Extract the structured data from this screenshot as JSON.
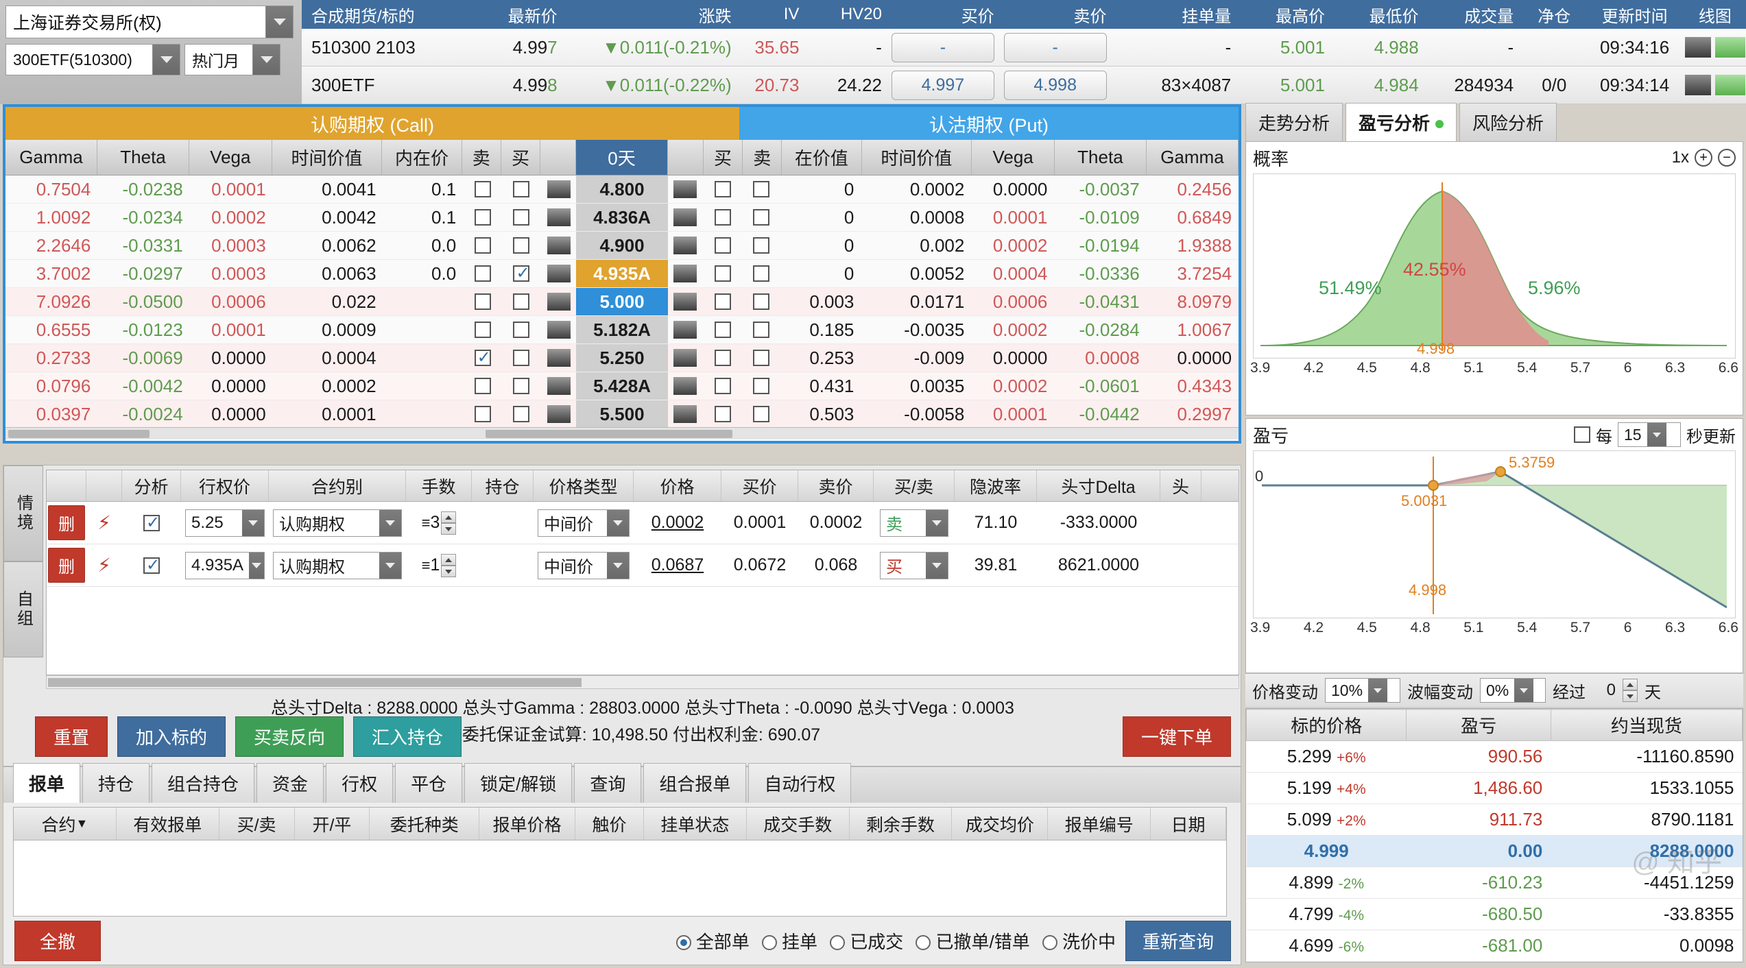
{
  "header": {
    "exchange": "上海证券交易所(权)",
    "underlying": "300ETF(510300)",
    "month": "热门月",
    "quote_columns": [
      "合成期货/标的",
      "最新价",
      "涨跌",
      "IV",
      "HV20",
      "买价",
      "卖价",
      "挂单量",
      "最高价",
      "最低价",
      "成交量",
      "净仓",
      "更新时间",
      "线图"
    ],
    "quote_rows": [
      {
        "name": "510300 2103",
        "last": "4.997",
        "last_tail": "7",
        "chg": "▼0.011(-0.21%)",
        "iv": "35.65",
        "hv20": "-",
        "bid": "-",
        "ask": "-",
        "qty": "-",
        "high": "5.001",
        "low": "4.988",
        "vol": "-",
        "net": "",
        "time": "09:34:16"
      },
      {
        "name": "300ETF",
        "last": "4.998",
        "last_tail": "8",
        "chg": "▼0.011(-0.22%)",
        "iv": "20.73",
        "hv20": "24.22",
        "bid": "4.997",
        "ask": "4.998",
        "qty": "83×4087",
        "high": "5.001",
        "low": "4.984",
        "vol": "284934",
        "net": "0/0",
        "time": "09:34:14"
      }
    ]
  },
  "chain": {
    "call_title": "认购期权 (Call)",
    "put_title": "认沽期权 (Put)",
    "call_cols": [
      "Gamma",
      "Theta",
      "Vega",
      "时间价值",
      "内在价",
      "卖",
      "买",
      ""
    ],
    "strike_col": "0天",
    "put_cols": [
      "",
      "买",
      "卖",
      "在价值",
      "时间价值",
      "Vega",
      "Theta",
      "Gamma"
    ],
    "rows": [
      {
        "c_gamma": "0.7504",
        "c_theta": "-0.0238",
        "c_vega": "0.0001",
        "c_tv": "0.0041",
        "c_iv": "0.1",
        "c_sell": false,
        "c_buy": false,
        "strike": "4.800",
        "hl": "none",
        "p_buy": false,
        "p_sell": false,
        "p_iv": "0",
        "p_tv": "0.0002",
        "p_vega": "0.0000",
        "p_theta": "-0.0037",
        "p_gamma": "0.2456",
        "tint": "none"
      },
      {
        "c_gamma": "1.0092",
        "c_theta": "-0.0234",
        "c_vega": "0.0002",
        "c_tv": "0.0042",
        "c_iv": "0.1",
        "c_sell": false,
        "c_buy": false,
        "strike": "4.836A",
        "hl": "none",
        "p_buy": false,
        "p_sell": false,
        "p_iv": "0",
        "p_tv": "0.0008",
        "p_vega": "0.0001",
        "p_theta": "-0.0109",
        "p_gamma": "0.6849",
        "tint": "none"
      },
      {
        "c_gamma": "2.2646",
        "c_theta": "-0.0331",
        "c_vega": "0.0003",
        "c_tv": "0.0062",
        "c_iv": "0.0",
        "c_sell": false,
        "c_buy": false,
        "strike": "4.900",
        "hl": "none",
        "p_buy": false,
        "p_sell": false,
        "p_iv": "0",
        "p_tv": "0.002",
        "p_vega": "0.0002",
        "p_theta": "-0.0194",
        "p_gamma": "1.9388",
        "tint": "none"
      },
      {
        "c_gamma": "3.7002",
        "c_theta": "-0.0297",
        "c_vega": "0.0003",
        "c_tv": "0.0063",
        "c_iv": "0.0",
        "c_sell": false,
        "c_buy": true,
        "strike": "4.935A",
        "hl": "orange",
        "p_buy": false,
        "p_sell": false,
        "p_iv": "0",
        "p_tv": "0.0052",
        "p_vega": "0.0004",
        "p_theta": "-0.0336",
        "p_gamma": "3.7254",
        "tint": "none"
      },
      {
        "c_gamma": "7.0926",
        "c_theta": "-0.0500",
        "c_vega": "0.0006",
        "c_tv": "0.022",
        "c_iv": "",
        "c_sell": false,
        "c_buy": false,
        "strike": "5.000",
        "hl": "blue",
        "p_buy": false,
        "p_sell": false,
        "p_iv": "0.003",
        "p_tv": "0.0171",
        "p_vega": "0.0006",
        "p_theta": "-0.0431",
        "p_gamma": "8.0979",
        "tint": "a"
      },
      {
        "c_gamma": "0.6555",
        "c_theta": "-0.0123",
        "c_vega": "0.0001",
        "c_tv": "0.0009",
        "c_iv": "",
        "c_sell": false,
        "c_buy": false,
        "strike": "5.182A",
        "hl": "none",
        "p_buy": false,
        "p_sell": false,
        "p_iv": "0.185",
        "p_tv": "-0.0035",
        "p_vega": "0.0002",
        "p_theta": "-0.0284",
        "p_gamma": "1.0067",
        "tint": "none"
      },
      {
        "c_gamma": "0.2733",
        "c_theta": "-0.0069",
        "c_vega": "0.0000",
        "c_tv": "0.0004",
        "c_iv": "",
        "c_sell": true,
        "c_buy": false,
        "strike": "5.250",
        "hl": "none",
        "p_buy": false,
        "p_sell": false,
        "p_iv": "0.253",
        "p_tv": "-0.009",
        "p_vega": "0.0000",
        "p_theta": "0.0008",
        "p_gamma": "0.0000",
        "tint": "a"
      },
      {
        "c_gamma": "0.0796",
        "c_theta": "-0.0042",
        "c_vega": "0.0000",
        "c_tv": "0.0002",
        "c_iv": "",
        "c_sell": false,
        "c_buy": false,
        "strike": "5.428A",
        "hl": "none",
        "p_buy": false,
        "p_sell": false,
        "p_iv": "0.431",
        "p_tv": "0.0035",
        "p_vega": "0.0002",
        "p_theta": "-0.0601",
        "p_gamma": "0.4343",
        "tint": "b"
      },
      {
        "c_gamma": "0.0397",
        "c_theta": "-0.0024",
        "c_vega": "0.0000",
        "c_tv": "0.0001",
        "c_iv": "",
        "c_sell": false,
        "c_buy": false,
        "strike": "5.500",
        "hl": "none",
        "p_buy": false,
        "p_sell": false,
        "p_iv": "0.503",
        "p_tv": "-0.0058",
        "p_vega": "0.0001",
        "p_theta": "-0.0442",
        "p_gamma": "0.2997",
        "tint": "a"
      }
    ]
  },
  "strategy": {
    "vtabs": [
      "情境",
      "自组"
    ],
    "columns": [
      "",
      "",
      "分析",
      "行权价",
      "合约别",
      "手数",
      "持仓",
      "价格类型",
      "价格",
      "买价",
      "卖价",
      "买/卖",
      "隐波率",
      "头寸Delta",
      "头"
    ],
    "rows": [
      {
        "del": "删",
        "analysis": true,
        "strike": "5.25",
        "type": "认购期权",
        "lots": "3",
        "pos": "",
        "price_type": "中间价",
        "price": "0.0002",
        "bid": "0.0001",
        "ask": "0.0002",
        "side": "卖",
        "iv": "71.10",
        "delta": "-333.0000"
      },
      {
        "del": "删",
        "analysis": true,
        "strike": "4.935A",
        "type": "认购期权",
        "lots": "1",
        "pos": "",
        "price_type": "中间价",
        "price": "0.0687",
        "bid": "0.0672",
        "ask": "0.068",
        "side": "买",
        "iv": "39.81",
        "delta": "8621.0000"
      }
    ],
    "totals": "总头寸Delta : 8288.0000  总头寸Gamma : 28803.0000  总头寸Theta : -0.0090    总头寸Vega : 0.0003",
    "margin": "委托保证金试算: 10,498.50  付出权利金: 690.07",
    "buttons": [
      "重置",
      "加入标的",
      "买卖反向",
      "汇入持仓"
    ],
    "one_key": "一键下单"
  },
  "orders": {
    "tabs": [
      "报单",
      "持仓",
      "组合持仓",
      "资金",
      "行权",
      "平仓",
      "锁定/解锁",
      "查询",
      "组合报单",
      "自动行权"
    ],
    "active_tab": "报单",
    "columns": [
      "合约",
      "有效报单",
      "买/卖",
      "开/平",
      "委托种类",
      "报单价格",
      "触价",
      "挂单状态",
      "成交手数",
      "剩余手数",
      "成交均价",
      "报单编号",
      "日期"
    ],
    "cancel_all": "全撤",
    "filters": [
      "全部单",
      "挂单",
      "已成交",
      "已撤单/错单",
      "洗价中"
    ],
    "active_filter": "全部单",
    "requery": "重新查询"
  },
  "right": {
    "tabs": [
      "走势分析",
      "盈亏分析",
      "风险分析"
    ],
    "active_tab": "盈亏分析",
    "prob": {
      "title": "概率",
      "zoom": "1x",
      "left_pct": "51.49%",
      "mid_pct": "42.55%",
      "right_pct": "5.96%",
      "center_label": "4.998",
      "ticks": [
        "3.9",
        "4.2",
        "4.5",
        "4.8",
        "5.1",
        "5.4",
        "5.7",
        "6",
        "6.3",
        "6.6"
      ]
    },
    "pnl": {
      "title": "盈亏",
      "refresh_label_pre": "每",
      "refresh_value": "15",
      "refresh_label_post": "秒更新",
      "zero_label": "0",
      "point_left": "5.0031",
      "point_right": "5.3759",
      "center_label": "4.998",
      "ticks": [
        "3.9",
        "4.2",
        "4.5",
        "4.8",
        "5.1",
        "5.4",
        "5.7",
        "6",
        "6.3",
        "6.6"
      ]
    },
    "controls": {
      "price_change_label": "价格变动",
      "price_change_value": "10%",
      "vol_change_label": "波幅变动",
      "vol_change_value": "0%",
      "elapsed_label": "经过",
      "elapsed_value": "0",
      "day_label": "天"
    },
    "table": {
      "columns": [
        "标的价格",
        "盈亏",
        "约当现货"
      ],
      "rows": [
        {
          "price": "5.299",
          "pct": "+6%",
          "pnl": "990.56",
          "eq": "-11160.8590",
          "sel": false,
          "pnl_color": "red"
        },
        {
          "price": "5.199",
          "pct": "+4%",
          "pnl": "1,486.60",
          "eq": "1533.1055",
          "sel": false,
          "pnl_color": "red"
        },
        {
          "price": "5.099",
          "pct": "+2%",
          "pnl": "911.73",
          "eq": "8790.1181",
          "sel": false,
          "pnl_color": "red"
        },
        {
          "price": "4.999",
          "pct": "",
          "pnl": "0.00",
          "eq": "8288.0000",
          "sel": true,
          "pnl_color": "blue"
        },
        {
          "price": "4.899",
          "pct": "-2%",
          "pnl": "-610.23",
          "eq": "-4451.1259",
          "sel": false,
          "pnl_color": "green"
        },
        {
          "price": "4.799",
          "pct": "-4%",
          "pnl": "-680.50",
          "eq": "-33.8355",
          "sel": false,
          "pnl_color": "green"
        },
        {
          "price": "4.699",
          "pct": "-6%",
          "pnl": "-681.00",
          "eq": "0.0098",
          "sel": false,
          "pnl_color": "green"
        }
      ]
    },
    "watermark": "@ 知乎"
  },
  "chart_data": [
    {
      "type": "area",
      "title": "概率",
      "x": [
        3.9,
        4.2,
        4.5,
        4.8,
        5.1,
        5.4,
        5.7,
        6.0,
        6.3,
        6.6
      ],
      "regions": [
        {
          "name": "left",
          "label": "51.49%",
          "color": "#a8d79a",
          "from": 3.9,
          "to": 4.998
        },
        {
          "name": "mid",
          "label": "42.55%",
          "color": "#e8a6a6",
          "from": 4.998,
          "to": 5.25
        },
        {
          "name": "right",
          "label": "5.96%",
          "color": "#a8d79a",
          "from": 5.25,
          "to": 6.6
        }
      ],
      "marker": 4.998,
      "xlabel": "",
      "ylabel": "",
      "grid": false
    },
    {
      "type": "line",
      "title": "盈亏",
      "x": [
        3.9,
        4.2,
        4.5,
        4.8,
        5.0031,
        5.25,
        5.3759,
        6.0,
        6.6
      ],
      "values": [
        0,
        0,
        0,
        0,
        0,
        430,
        520,
        -900,
        -1700
      ],
      "markers": [
        {
          "x": 5.0031,
          "label": "5.0031"
        },
        {
          "x": 5.3759,
          "label": "5.3759"
        }
      ],
      "zero_line": 0,
      "marker_vline": 4.998,
      "xlabel": "",
      "ylabel": "",
      "grid": false
    }
  ]
}
